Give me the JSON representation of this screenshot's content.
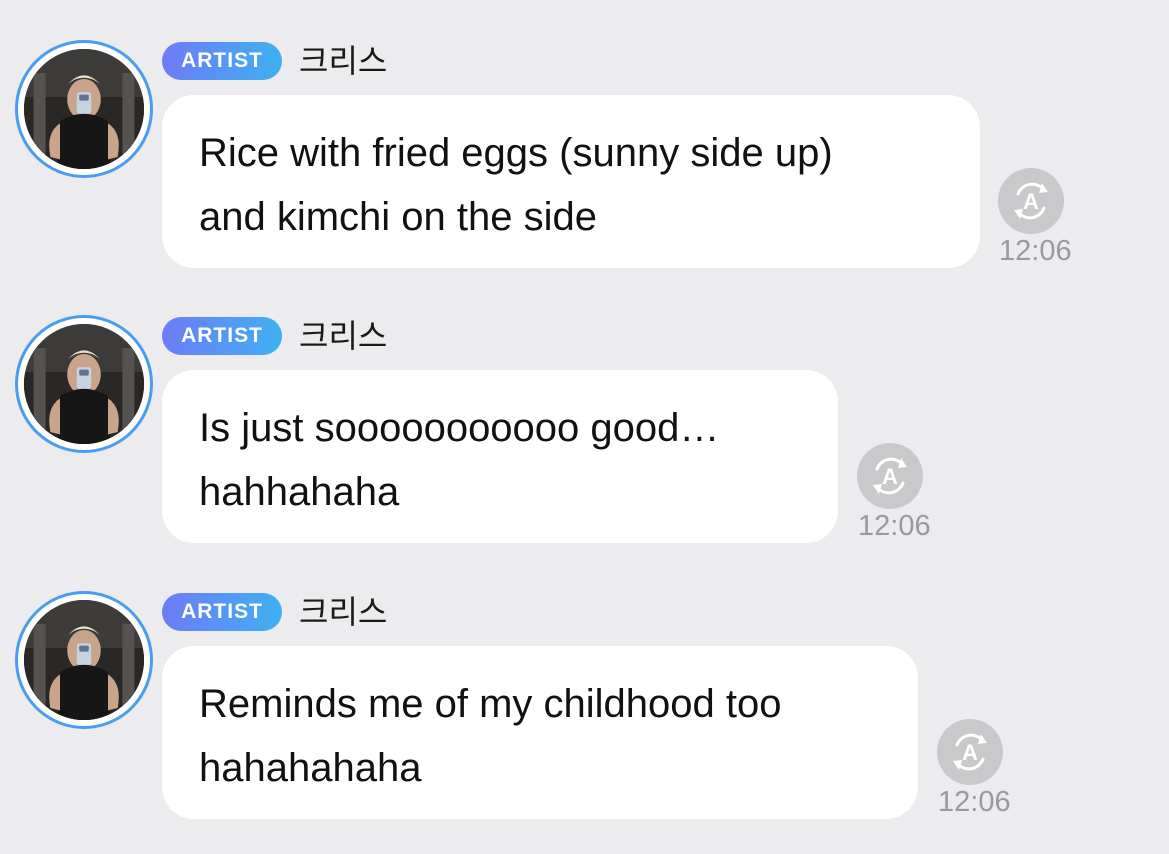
{
  "messages": [
    {
      "badge": "ARTIST",
      "username": "크리스",
      "lines": [
        "Rice with fried eggs (sunny side up)",
        "and kimchi on the side"
      ],
      "time": "12:06",
      "translate_icon": "translate-a-icon"
    },
    {
      "badge": "ARTIST",
      "username": "크리스",
      "lines": [
        "Is just sooooooooooo good…",
        "hahhahaha"
      ],
      "time": "12:06",
      "translate_icon": "translate-a-icon"
    },
    {
      "badge": "ARTIST",
      "username": "크리스",
      "lines": [
        "Reminds me of my childhood too",
        "hahahahaha"
      ],
      "time": "12:06",
      "translate_icon": "translate-a-icon"
    }
  ],
  "colors": {
    "background": "#ececee",
    "bubble": "#ffffff",
    "badge_start": "#6d7cf6",
    "badge_end": "#3fb0f2",
    "avatar_ring": "#4a9bf2",
    "timestamp": "#9a9a9e",
    "icon_bg": "#c9c9cc"
  }
}
